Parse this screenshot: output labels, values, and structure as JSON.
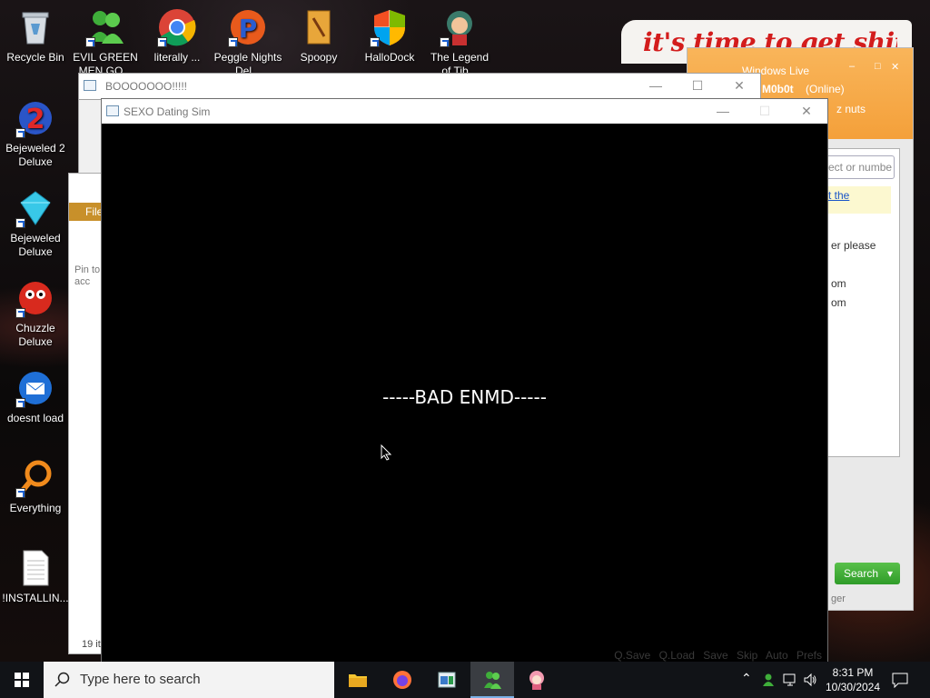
{
  "desktop": {
    "icons": [
      {
        "name": "recycle-bin-icon",
        "label": "Recycle Bin"
      },
      {
        "name": "bejeweled2-icon",
        "label": "Bejeweled 2 Deluxe"
      },
      {
        "name": "bejeweled-icon",
        "label": "Bejeweled Deluxe"
      },
      {
        "name": "chuzzle-icon",
        "label": "Chuzzle Deluxe"
      },
      {
        "name": "thunderbird-icon",
        "label": "doesnt load"
      },
      {
        "name": "everything-icon",
        "label": "Everything"
      },
      {
        "name": "text-file-icon",
        "label": "!INSTALLIN..."
      },
      {
        "name": "messenger-icon",
        "label": "EVIL GREEN MEN GO..."
      },
      {
        "name": "chrome-icon",
        "label": "literally ..."
      },
      {
        "name": "peggle-icon",
        "label": "Peggle Nights Del..."
      },
      {
        "name": "spoopy-icon",
        "label": "Spoopy"
      },
      {
        "name": "hallodock-icon",
        "label": "HalloDock"
      },
      {
        "name": "legend-icon",
        "label": "The Legend of Tib..."
      }
    ],
    "banner_text": "it's time to get shit"
  },
  "messenger": {
    "title": "Windows Live",
    "username": "M0b0t",
    "status": "(Online)",
    "personal_message": "z nuts",
    "search_placeholder": "ect or numbe",
    "link_text": "t the",
    "lines": [
      "er please",
      "om",
      "om"
    ],
    "search_button": "Search",
    "footer": "ger"
  },
  "explorer": {
    "ribbon_file": "File",
    "pin_text": "Pin to acc",
    "item_count": "19 it"
  },
  "boo_window": {
    "title": "BOOOOOOO!!!!!"
  },
  "game": {
    "title": "SEXO Dating Sim",
    "ending_text": "-----BAD ENMD-----",
    "quickmenu": "Q.Save  Q.Load  Save  Skip  Auto  Prefs"
  },
  "taskbar": {
    "search_placeholder": "Type here to search",
    "time": "8:31 PM",
    "date": "10/30/2024"
  }
}
